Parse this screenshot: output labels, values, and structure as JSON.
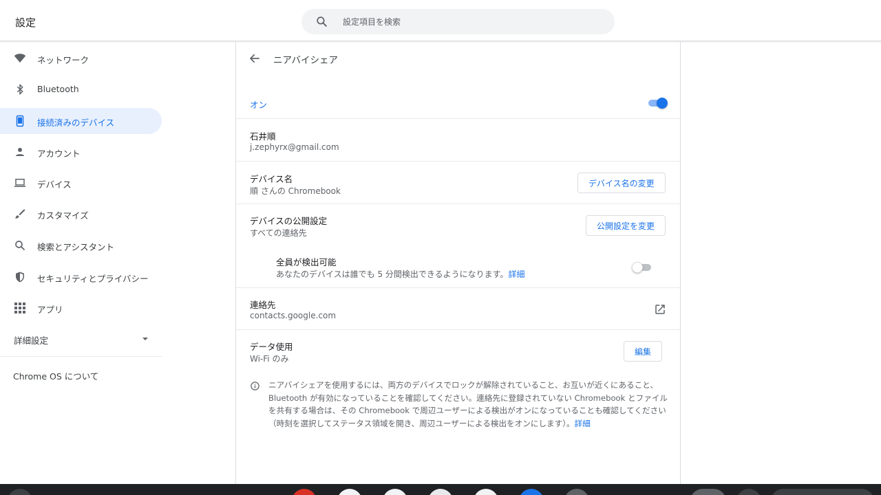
{
  "header": {
    "title": "設定",
    "search": {
      "placeholder": "設定項目を検索"
    }
  },
  "sidebar": {
    "items": [
      {
        "label": "ネットワーク",
        "icon": "wifi-icon"
      },
      {
        "label": "Bluetooth",
        "icon": "bluetooth-icon"
      },
      {
        "label": "接続済みのデバイス",
        "icon": "phone-icon",
        "active": true
      },
      {
        "label": "アカウント",
        "icon": "person-icon"
      },
      {
        "label": "デバイス",
        "icon": "laptop-icon"
      },
      {
        "label": "カスタマイズ",
        "icon": "brush-icon"
      },
      {
        "label": "検索とアシスタント",
        "icon": "search-icon"
      },
      {
        "label": "セキュリティとプライバシー",
        "icon": "shield-icon"
      },
      {
        "label": "アプリ",
        "icon": "apps-grid-icon"
      }
    ],
    "advanced_label": "詳細設定",
    "about_label": "Chrome OS について"
  },
  "page": {
    "title": "ニアバイシェア",
    "enabled": {
      "label": "オン",
      "on": true
    },
    "account": {
      "name": "石井順",
      "email": "j.zephyrx@gmail.com"
    },
    "device_name": {
      "label": "デバイス名",
      "value": "順 さんの Chromebook",
      "button": "デバイス名の変更"
    },
    "visibility": {
      "label": "デバイスの公開設定",
      "value": "すべての連絡先",
      "button": "公開設定を変更"
    },
    "everyone": {
      "label": "全員が検出可能",
      "desc": "あなたのデバイスは誰でも 5 分間検出できるようになります。",
      "link": "詳細",
      "on": false
    },
    "contacts": {
      "label": "連絡先",
      "value": "contacts.google.com"
    },
    "data_usage": {
      "label": "データ使用",
      "value": "Wi-Fi のみ",
      "button": "編集"
    },
    "info": {
      "text": "ニアバイシェアを使用するには、両方のデバイスでロックが解除されていること、お互いが近くにあること、Bluetooth が有効になっていることを確認してください。連絡先に登録されていない Chromebook とファイルを共有する場合は、その Chromebook で周辺ユーザーによる検出がオンになっていることも確認してください（時刻を選択してステータス領域を開き、周辺ユーザーによる検出をオンにします）。",
      "link": "詳細"
    }
  },
  "colors": {
    "accent": "#1a73e8",
    "active_bg": "#e8f0fe",
    "shelf": "#202124"
  }
}
